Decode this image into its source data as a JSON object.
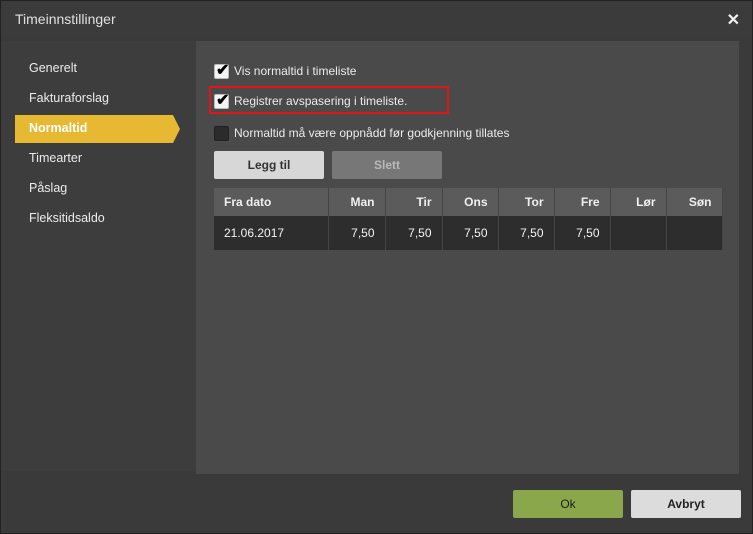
{
  "window": {
    "title": "Timeinnstillinger",
    "close_glyph": "✕"
  },
  "sidebar": {
    "items": [
      {
        "label": "Generelt"
      },
      {
        "label": "Fakturaforslag"
      },
      {
        "label": "Normaltid",
        "active": true
      },
      {
        "label": "Timearter"
      },
      {
        "label": "Påslag"
      },
      {
        "label": "Fleksitidsaldo"
      }
    ]
  },
  "options": [
    {
      "label": "Vis normaltid i timeliste",
      "checked": true
    },
    {
      "label": "Registrer avspasering i timeliste.",
      "checked": true,
      "highlighted": true
    },
    {
      "label": "Normaltid må være oppnådd før godkjenning tillates",
      "checked": false
    }
  ],
  "actions": {
    "add_label": "Legg til",
    "delete_label": "Slett"
  },
  "table": {
    "headers": [
      "Fra dato",
      "Man",
      "Tir",
      "Ons",
      "Tor",
      "Fre",
      "Lør",
      "Søn"
    ],
    "rows": [
      [
        "21.06.2017",
        "7,50",
        "7,50",
        "7,50",
        "7,50",
        "7,50",
        "",
        ""
      ]
    ]
  },
  "footer": {
    "ok_label": "Ok",
    "cancel_label": "Avbryt"
  },
  "colors": {
    "accent": "#e7b831",
    "ok": "#8aa84b",
    "highlight": "#e01616"
  }
}
